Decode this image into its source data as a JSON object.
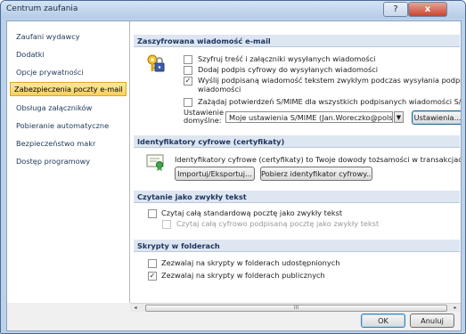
{
  "window": {
    "title": "Centrum zaufania",
    "help_label": "?",
    "close_label": "x"
  },
  "sidebar": {
    "items": [
      {
        "label": "Zaufani wydawcy"
      },
      {
        "label": "Dodatki"
      },
      {
        "label": "Opcje prywatności"
      },
      {
        "label": "Zabezpieczenia poczty e-mail",
        "selected": true
      },
      {
        "label": "Obsługa załączników"
      },
      {
        "label": "Pobieranie automatyczne"
      },
      {
        "label": "Bezpieczeństwo makr"
      },
      {
        "label": "Dostęp programowy"
      }
    ]
  },
  "encrypted": {
    "header": "Zaszyfrowana wiadomość e-mail",
    "icon": "lock-key-icon",
    "options": [
      {
        "label": "Szyfruj treść i załączniki wysyłanych wiadomości",
        "checked": false
      },
      {
        "label": "Dodaj podpis cyfrowy do wysyłanych wiadomości",
        "checked": false
      },
      {
        "label": "Wyślij podpisaną wiadomość tekstem zwykłym podczas wysyłania podpisanych",
        "label2": "wiadomości",
        "checked": true
      },
      {
        "label": "Zażądaj potwierdzeń S/MIME dla wszystkich podpisanych wiadomości S/MIME",
        "checked": false
      }
    ],
    "defaults_label_1": "Ustawienie",
    "defaults_label_2": "domyślne:",
    "defaults_value": "Moje ustawienia S/MIME (Jan.Woreczko@polsl.pl)",
    "settings_button": "Ustawienia..."
  },
  "digital_ids": {
    "header": "Identyfikatory cyfrowe (certyfikaty)",
    "icon": "certificate-icon",
    "description": "Identyfikatory cyfrowe (certyfikaty) to Twoje dowody tożsamości w transakcjach cyfrowych.",
    "import_button": "Importuj/Eksportuj...",
    "get_button": "Pobierz identyfikator cyfrowy..."
  },
  "plain_text": {
    "header": "Czytanie jako zwykły tekst",
    "options": [
      {
        "label": "Czytaj całą standardową pocztę jako zwykły tekst",
        "checked": false,
        "enabled": true
      },
      {
        "label": "Czytaj całą cyfrowo podpisaną pocztę jako zwykły tekst",
        "checked": false,
        "enabled": false
      }
    ]
  },
  "folder_scripts": {
    "header": "Skrypty w folderach",
    "options": [
      {
        "label": "Zezwalaj na skrypty w folderach udostępnionych",
        "checked": false
      },
      {
        "label": "Zezwalaj na skrypty w folderach publicznych",
        "checked": true
      }
    ]
  },
  "footer": {
    "ok_label": "OK",
    "cancel_label": "Anuluj"
  },
  "scrollbar": {
    "grip": "III"
  }
}
